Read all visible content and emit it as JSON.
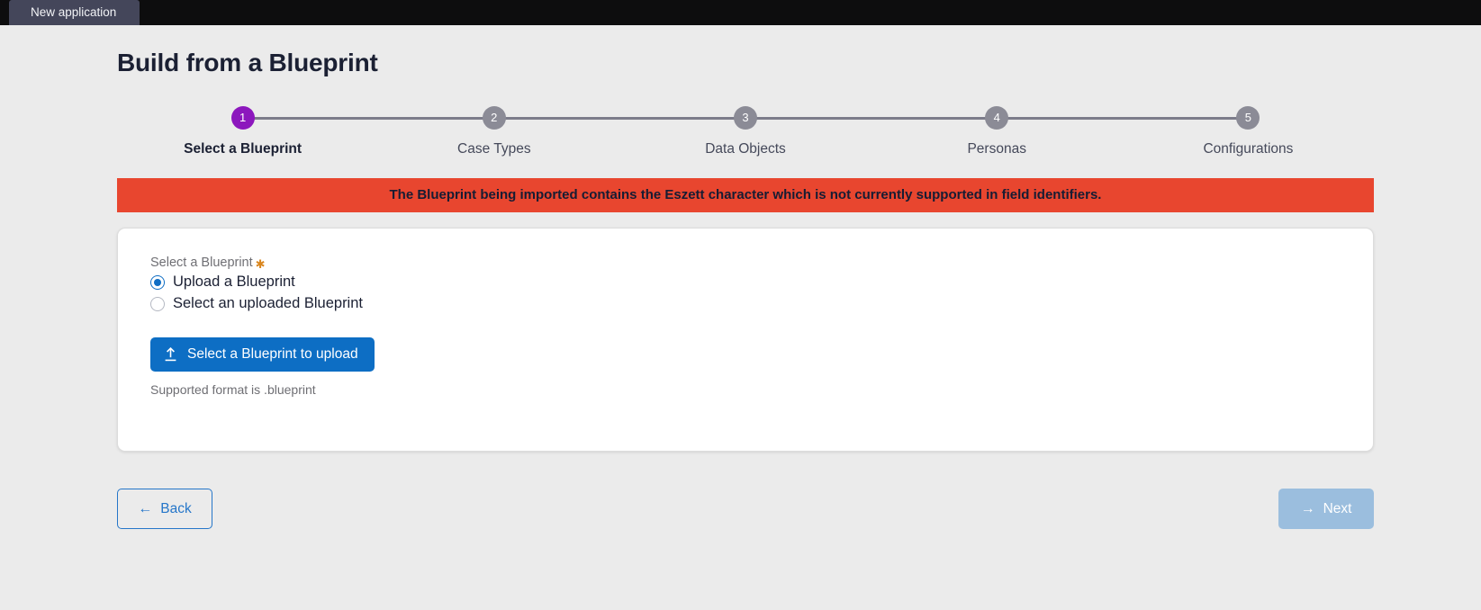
{
  "window": {
    "tab_label": "New application"
  },
  "header": {
    "title": "Build from a Blueprint"
  },
  "stepper": {
    "active_index": 0,
    "active_color": "#8c17bd",
    "inactive_color": "#8b8b96",
    "steps": [
      {
        "number": "1",
        "label": "Select a Blueprint"
      },
      {
        "number": "2",
        "label": "Case Types"
      },
      {
        "number": "3",
        "label": "Data Objects"
      },
      {
        "number": "4",
        "label": "Personas"
      },
      {
        "number": "5",
        "label": "Configurations"
      }
    ]
  },
  "banner": {
    "message": "The Blueprint being imported contains the Eszett character which is not currently supported in field identifiers.",
    "background": "#e8462f",
    "text_color": "#161c33"
  },
  "form": {
    "field_label": "Select a Blueprint",
    "required_marker": "✱",
    "options": [
      {
        "label": "Upload a Blueprint",
        "selected": true
      },
      {
        "label": "Select an uploaded Blueprint",
        "selected": false
      }
    ],
    "upload_button": {
      "label": "Select a Blueprint to upload",
      "icon": "upload-icon",
      "background": "#0d6ec4"
    },
    "helper_text": "Supported format is .blueprint"
  },
  "footer": {
    "back": {
      "label": "Back",
      "icon": "arrow-left-icon"
    },
    "next": {
      "label": "Next",
      "icon": "arrow-right-icon",
      "disabled": true
    }
  }
}
